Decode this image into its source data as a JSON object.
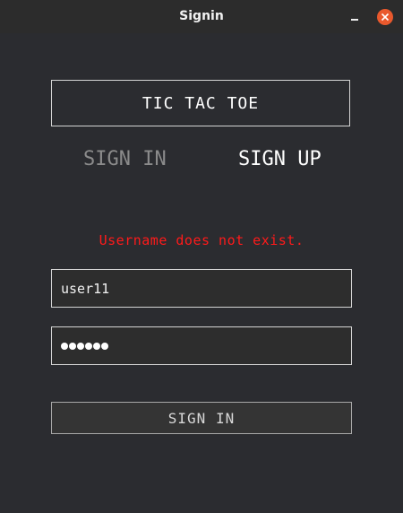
{
  "window": {
    "title": "Signin",
    "close_color": "#e9592d"
  },
  "brand": {
    "label": "TIC TAC TOE"
  },
  "tabs": [
    {
      "label": "SIGN IN",
      "active": false
    },
    {
      "label": "SIGN UP",
      "active": true
    }
  ],
  "form": {
    "error_message": "Username does not exist.",
    "error_color": "#ff1a1a",
    "username_value": "user11",
    "password_mask_count": 6,
    "submit_label": "SIGN IN"
  }
}
